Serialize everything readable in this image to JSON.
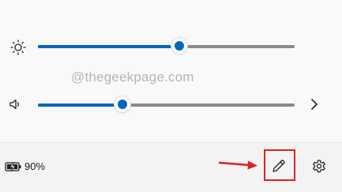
{
  "brightness": {
    "icon": "brightness-sun-icon",
    "level_percent": 55
  },
  "volume": {
    "icon": "speaker-volume-icon",
    "level_percent": 33,
    "expand_icon": "chevron-right-icon"
  },
  "watermark": {
    "text": "@thegeekpage.com"
  },
  "footer": {
    "battery_icon": "battery-charging-icon",
    "battery_percent": "90%",
    "edit_icon": "pencil-edit-icon",
    "settings_icon": "gear-settings-icon"
  },
  "annotation": {
    "arrow_color": "#e02020",
    "box_color": "#e02020"
  },
  "colors": {
    "accent": "#0067c0",
    "track": "#8a8a8a"
  }
}
